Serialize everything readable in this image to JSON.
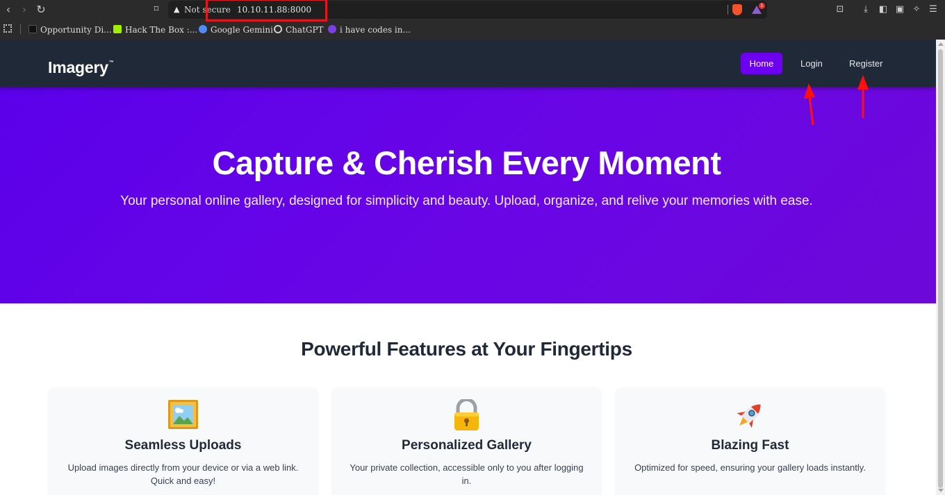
{
  "browser": {
    "security_label": "Not secure",
    "url": "10.10.11.88:8000",
    "rewards_badge_count": "1",
    "bookmarks": [
      {
        "label": "Opportunity Di...",
        "icon": "opportunity-icon",
        "color": "#111111"
      },
      {
        "label": "Hack The Box :...",
        "icon": "hackthebox-icon",
        "color": "#9fef00"
      },
      {
        "label": "Google Gemini",
        "icon": "gemini-icon",
        "color": "#4f8cf7"
      },
      {
        "label": "ChatGPT",
        "icon": "chatgpt-icon",
        "color": "#cfcfcf"
      },
      {
        "label": "i have codes in...",
        "icon": "chat-icon",
        "color": "#7b3fe4"
      }
    ],
    "highlight_color": "#e3161b"
  },
  "site": {
    "logo": "Imagery",
    "logo_mark": "™",
    "nav": {
      "home": "Home",
      "login": "Login",
      "register": "Register"
    },
    "accent_color": "#6d00f0",
    "header_color": "#1f2937"
  },
  "hero": {
    "title": "Capture & Cherish Every Moment",
    "subtitle": "Your personal online gallery, designed for simplicity and beauty. Upload, organize, and relive your memories with ease."
  },
  "features": {
    "title": "Powerful Features at Your Fingertips",
    "cards": [
      {
        "icon": "framed-picture-icon",
        "title": "Seamless Uploads",
        "description": "Upload images directly from your device or via a web link. Quick and easy!"
      },
      {
        "icon": "lock-icon",
        "title": "Personalized Gallery",
        "description": "Your private collection, accessible only to you after logging in."
      },
      {
        "icon": "rocket-icon",
        "title": "Blazing Fast",
        "description": "Optimized for speed, ensuring your gallery loads instantly."
      }
    ]
  },
  "annotations": {
    "arrow_color": "#ff1010"
  }
}
